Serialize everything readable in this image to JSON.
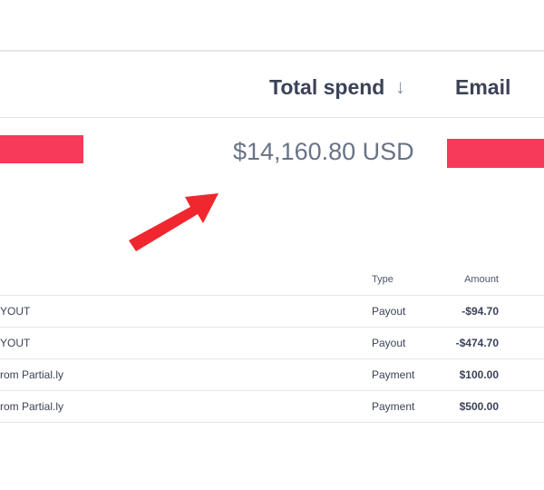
{
  "customers_table": {
    "columns": {
      "total_spend": "Total spend",
      "sort_indicator": "↓",
      "email": "Email"
    },
    "row": {
      "total_spend": "$14,160.80 USD",
      "name_redacted": true,
      "email_redacted": true
    }
  },
  "annotation": {
    "arrow_color": "#f0272f",
    "redaction_color": "#f7395a"
  },
  "transactions_table": {
    "columns": {
      "type": "Type",
      "amount": "Amount"
    },
    "rows": [
      {
        "description": "YOUT",
        "type": "Payout",
        "amount": "-$94.70"
      },
      {
        "description": "YOUT",
        "type": "Payout",
        "amount": "-$474.70"
      },
      {
        "description": "rom Partial.ly",
        "type": "Payment",
        "amount": "$100.00"
      },
      {
        "description": "rom Partial.ly",
        "type": "Payment",
        "amount": "$500.00"
      }
    ]
  }
}
